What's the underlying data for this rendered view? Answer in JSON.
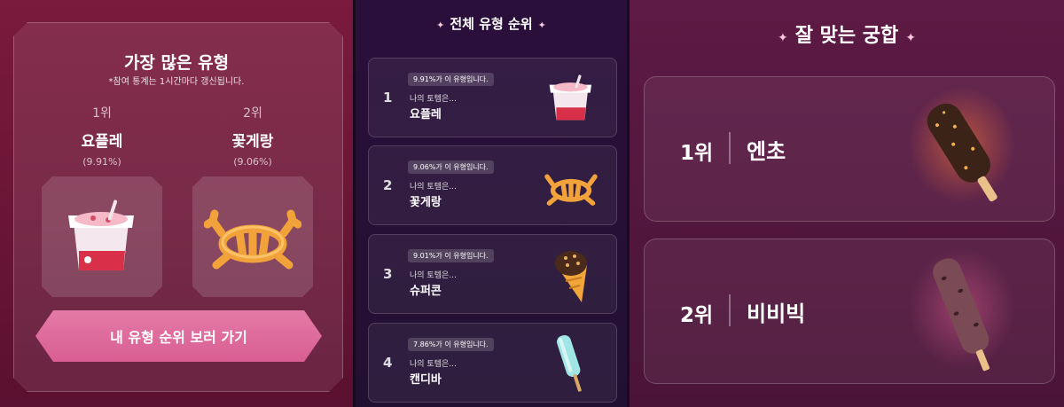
{
  "left": {
    "title": "가장 많은 유형",
    "subtitle": "*참여 통계는 1시간마다 갱신됩니다.",
    "top": [
      {
        "rank": "1위",
        "name": "요플레",
        "pct": "(9.91%)",
        "icon": "yogurt-cup-icon"
      },
      {
        "rank": "2위",
        "name": "꽃게랑",
        "pct": "(9.06%)",
        "icon": "crab-snack-icon"
      }
    ],
    "cta_label": "내 유형 순위 보러 가기"
  },
  "middle": {
    "title": "전체 유형 순위",
    "items": [
      {
        "num": "1",
        "badge": "9.91%가 이 유형입니다.",
        "label": "나의 토템은...",
        "name": "요플레",
        "icon": "yogurt-cup-icon"
      },
      {
        "num": "2",
        "badge": "9.06%가 이 유형입니다.",
        "label": "나의 토템은...",
        "name": "꽃게랑",
        "icon": "crab-snack-icon"
      },
      {
        "num": "3",
        "badge": "9.01%가 이 유형입니다.",
        "label": "나의 토템은...",
        "name": "슈퍼콘",
        "icon": "ice-cream-cone-icon"
      },
      {
        "num": "4",
        "badge": "7.86%가 이 유형입니다.",
        "label": "나의 토템은...",
        "name": "캔디바",
        "icon": "candy-bar-popsicle-icon"
      }
    ]
  },
  "right": {
    "title": "잘 맞는 궁합",
    "matches": [
      {
        "rank": "1위",
        "name": "엔초",
        "icon": "chocolate-popsicle-icon"
      },
      {
        "rank": "2위",
        "name": "비비빅",
        "icon": "red-bean-popsicle-icon"
      }
    ]
  },
  "colors": {
    "left_bg": "#7a1a3c",
    "middle_bg": "#2a0f3a",
    "right_bg": "#5d1a44",
    "cta": "#e37aa6",
    "sparkle": "#f5c6dc"
  }
}
